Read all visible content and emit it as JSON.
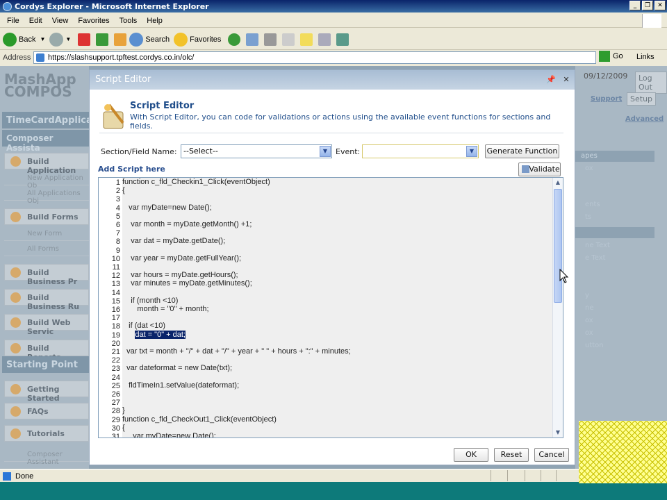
{
  "window": {
    "title": "Cordys Explorer - Microsoft Internet Explorer"
  },
  "menubar": [
    "File",
    "Edit",
    "View",
    "Favorites",
    "Tools",
    "Help"
  ],
  "toolbar": {
    "back": "Back",
    "search": "Search",
    "favorites": "Favorites"
  },
  "addressbar": {
    "label": "Address",
    "url": "https://slashsupport.tpftest.cordys.co.in/olc/",
    "go": "Go",
    "links": "Links"
  },
  "status": {
    "text": "Done"
  },
  "sidebar": {
    "logo_line1": "MashApp",
    "logo_line2": "COMPOS",
    "app_header": "TimeCardApplica",
    "assist_header": "Composer Assista",
    "build_application": "Build Application",
    "new_application": "New Application Ob",
    "all_applications": "All Applications Obj",
    "build_forms": "Build Forms",
    "new_form": "New Form",
    "all_forms": "All Forms",
    "build_business_pr": "Build Business Pr",
    "build_business_ru": "Build Business Ru",
    "build_web_servic": "Build Web Servic",
    "build_reports": "Build Reports",
    "starting_point": "Starting Point",
    "getting_started": "Getting Started",
    "faqs": "FAQs",
    "tutorials": "Tutorials",
    "composer_assistant": "Composer Assistant"
  },
  "rightpane": {
    "date": "09/12/2009",
    "logout": "Log Out",
    "support": "Support",
    "setup": "Setup",
    "advanced": "Advanced",
    "h1": "apes",
    "items1": [
      "ox",
      "",
      "ents",
      "ts"
    ],
    "items2": [
      "ne Text",
      "e Text",
      "",
      "",
      "y",
      "ne",
      "ox",
      "ox",
      "utton"
    ]
  },
  "dialog": {
    "title": "Script Editor",
    "heading": "Script Editor",
    "description": "With Script Editor, you can code for validations or actions using the available event functions for sections and fields.",
    "section_label": "Section/Field Name:",
    "section_value": "--Select--",
    "event_label": "Event:",
    "event_value": "",
    "generate_button": "Generate Function",
    "add_script": "Add Script here",
    "validate_button": "Validate",
    "ok_button": "OK",
    "reset_button": "Reset",
    "cancel_button": "Cancel"
  },
  "code": {
    "line_numbers": [
      "1",
      "2",
      "3",
      "4",
      "5",
      "6",
      "7",
      "8",
      "9",
      "10",
      "11",
      "12",
      "13",
      "14",
      "15",
      "16",
      "17",
      "18",
      "19",
      "20",
      "21",
      "22",
      "23",
      "24",
      "25",
      "26",
      "27",
      "28",
      "29",
      "30",
      "31"
    ],
    "lines": [
      "function c_fld_Checkin1_Click(eventObject)",
      "{",
      "",
      "   var myDate=new Date();",
      "",
      "    var month = myDate.getMonth() +1;",
      "",
      "    var dat = myDate.getDate();",
      "",
      "    var year = myDate.getFullYear();",
      "",
      "    var hours = myDate.getHours();",
      "    var minutes = myDate.getMinutes();",
      "",
      "    if (month <10)",
      "       month = \"0\" + month;",
      "",
      "   if (dat <10)",
      "      dat = \"0\" + dat;",
      "",
      "  var txt = month + \"/\" + dat + \"/\" + year + \" \" + hours + \":\" + minutes;",
      "",
      "  var dateformat = new Date(txt);",
      "",
      "   fldTimeIn1.setValue(dateformat);",
      "",
      "",
      "}",
      "function c_fld_CheckOut1_Click(eventObject)",
      "{",
      "     var myDate=new Date();"
    ]
  }
}
